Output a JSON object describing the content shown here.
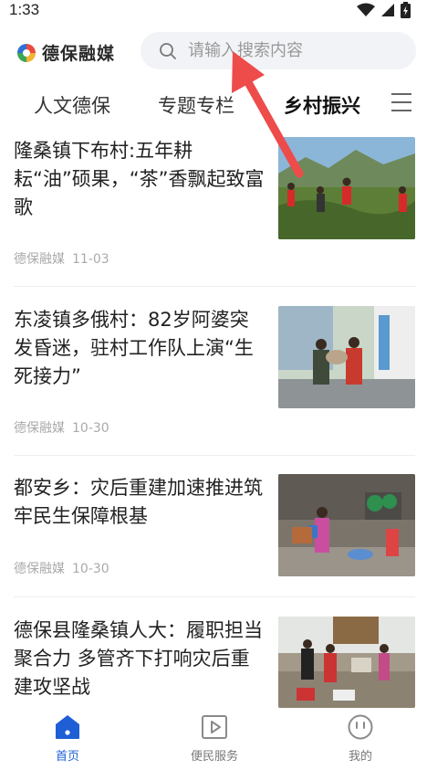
{
  "status": {
    "time": "1:33"
  },
  "header": {
    "logo_text": "德保融媒",
    "search_placeholder": "请输入搜索内容"
  },
  "tabs": [
    {
      "label": "人文德保",
      "active": false
    },
    {
      "label": "专题专栏",
      "active": false
    },
    {
      "label": "乡村振兴",
      "active": true
    }
  ],
  "news": [
    {
      "title": "隆桑镇下布村:五年耕耘“油”硕果，“茶”香飘起致富歌",
      "source": "德保融媒",
      "date": "11-03",
      "image": "volunteers-in-tea-field-photo"
    },
    {
      "title": "东凌镇多俄村：82岁阿婆突发昏迷，驻村工作队上演“生死接力”",
      "source": "德保融媒",
      "date": "10-30",
      "image": "rescue-carrying-elder-photo"
    },
    {
      "title": "都安乡：灾后重建加速推进筑牢民生保障根基",
      "source": "德保融媒",
      "date": "10-30",
      "image": "disinfection-spraying-photo"
    },
    {
      "title": "德保县隆桑镇人大：履职担当聚合力 多管齐下打响灾后重建攻坚战",
      "source": "",
      "date": "",
      "image": "relief-supplies-photo"
    }
  ],
  "bottom_nav": [
    {
      "label": "首页",
      "active": true
    },
    {
      "label": "便民服务",
      "active": false
    },
    {
      "label": "我的",
      "active": false
    }
  ],
  "colors": {
    "accent": "#1f5fd6",
    "annotation_arrow": "#ee4b4b"
  }
}
